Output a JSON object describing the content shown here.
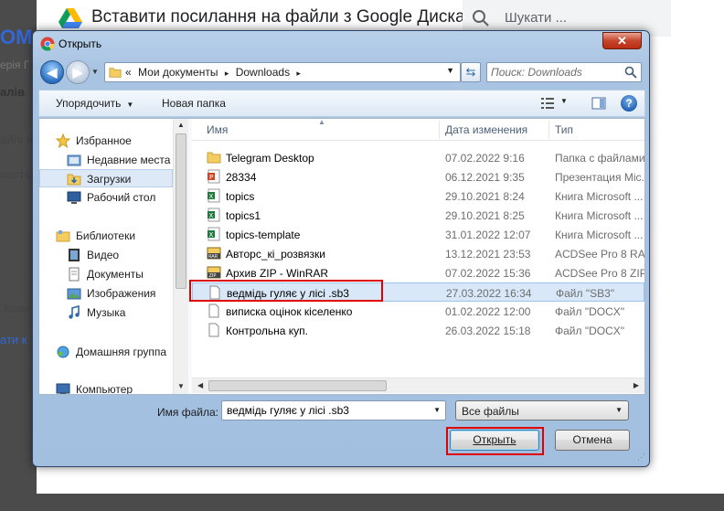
{
  "background": {
    "title": "Вставити посилання на файли з Google Диска",
    "search_placeholder": "Шукати ...",
    "fragments": [
      "ОМ",
      "ерія Г",
      "алів",
      "айлі н",
      "ишіть",
      "Коме",
      "ати к"
    ]
  },
  "dialog": {
    "title": "Открыть",
    "close_label": "✕",
    "breadcrumb": [
      "«",
      "Мои документы",
      "▸",
      "Downloads",
      "▸"
    ],
    "search_placeholder": "Поиск: Downloads",
    "toolbar": {
      "organize": "Упорядочить",
      "new_folder": "Новая папка"
    },
    "nav": [
      {
        "label": "Избранное",
        "icon": "star-icon"
      },
      {
        "label": "Недавние места",
        "icon": "recent-places-icon"
      },
      {
        "label": "Загрузки",
        "icon": "downloads-folder-icon",
        "selected": true
      },
      {
        "label": "Рабочий стол",
        "icon": "desktop-icon"
      },
      {
        "label": "Библиотеки",
        "icon": "libraries-icon"
      },
      {
        "label": "Видео",
        "icon": "video-icon"
      },
      {
        "label": "Документы",
        "icon": "documents-icon"
      },
      {
        "label": "Изображения",
        "icon": "images-icon"
      },
      {
        "label": "Музыка",
        "icon": "music-icon"
      },
      {
        "label": "Домашняя группа",
        "icon": "homegroup-icon"
      },
      {
        "label": "Компьютер",
        "icon": "computer-icon"
      }
    ],
    "columns": {
      "name": "Имя",
      "date": "Дата изменения",
      "type": "Тип"
    },
    "files": [
      {
        "name": "Telegram Desktop",
        "date": "07.02.2022 9:16",
        "type": "Папка с файлами",
        "icon": "folder-icon"
      },
      {
        "name": "28334",
        "date": "06.12.2021 9:35",
        "type": "Презентация Mic...",
        "icon": "powerpoint-icon"
      },
      {
        "name": "topics",
        "date": "29.10.2021 8:24",
        "type": "Книга Microsoft ...",
        "icon": "excel-icon"
      },
      {
        "name": "topics1",
        "date": "29.10.2021 8:25",
        "type": "Книга Microsoft ...",
        "icon": "excel-icon"
      },
      {
        "name": "topics-template",
        "date": "31.01.2022 12:07",
        "type": "Книга Microsoft ...",
        "icon": "excel-icon"
      },
      {
        "name": "Авторс_кі_розвязки",
        "date": "13.12.2021 23:53",
        "type": "ACDSee Pro 8 RAR ...",
        "icon": "rar-icon"
      },
      {
        "name": "Архив ZIP - WinRAR",
        "date": "07.02.2022 15:36",
        "type": "ACDSee Pro 8 ZIP ...",
        "icon": "zip-icon"
      },
      {
        "name": "ведмідь гуляє у лісі .sb3",
        "date": "27.03.2022 16:34",
        "type": "Файл \"SB3\"",
        "icon": "generic-file-icon",
        "selected": true
      },
      {
        "name": "виписка оцінок кіселенко",
        "date": "01.02.2022 12:00",
        "type": "Файл \"DOCX\"",
        "icon": "generic-file-icon"
      },
      {
        "name": "Контрольна куп.",
        "date": "26.03.2022 15:18",
        "type": "Файл \"DOCX\"",
        "icon": "generic-file-icon"
      }
    ],
    "filename_label": "Имя файла:",
    "filename_value": "ведмідь гуляє у лісі .sb3",
    "filetype": "Все файлы",
    "open_label": "Открыть",
    "cancel_label": "Отмена"
  },
  "colors": {
    "highlight_box": "#e00000",
    "selection": "#d9e8f8"
  }
}
